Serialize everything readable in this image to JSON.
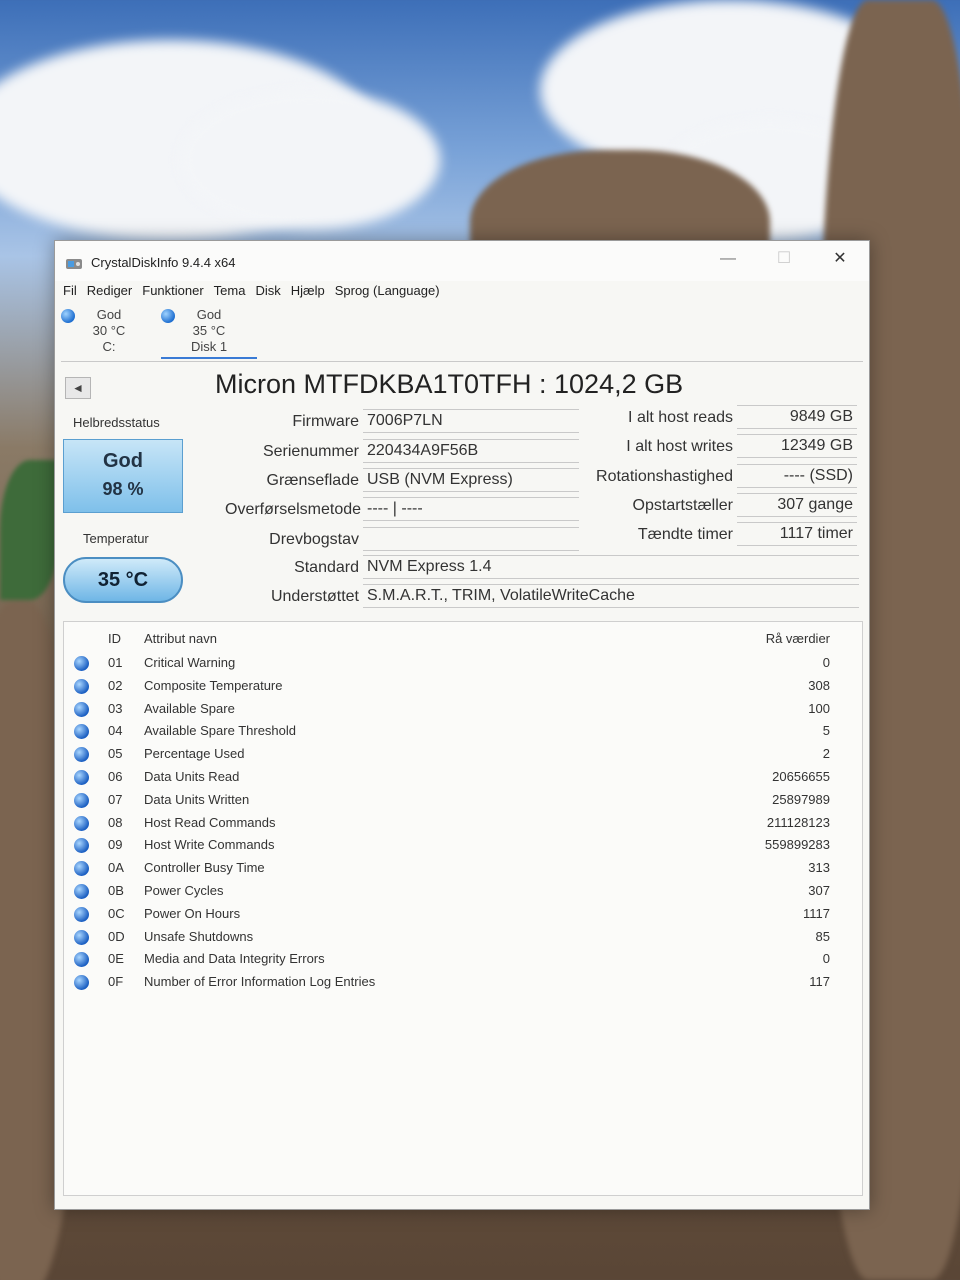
{
  "window": {
    "title": "CrystalDiskInfo 9.4.4 x64",
    "minimize_glyph": "—",
    "maximize_glyph": "☐",
    "close_glyph": "✕"
  },
  "menu": [
    "Fil",
    "Rediger",
    "Funktioner",
    "Tema",
    "Disk",
    "Hjælp",
    "Sprog (Language)"
  ],
  "disk_tabs": [
    {
      "status": "God",
      "temp": "30 °C",
      "label": "C:"
    },
    {
      "status": "God",
      "temp": "35 °C",
      "label": "Disk 1"
    }
  ],
  "model": {
    "title": "Micron MTFDKBA1T0TFH : 1024,2 GB",
    "nav_prev_glyph": "◄"
  },
  "health": {
    "label": "Helbredsstatus",
    "status": "God",
    "percent": "98 %",
    "temp_label": "Temperatur",
    "temp": "35 °C"
  },
  "info_left": [
    {
      "label": "Firmware",
      "value": "7006P7LN"
    },
    {
      "label": "Serienummer",
      "value": "220434A9F56B"
    },
    {
      "label": "Grænseflade",
      "value": "USB (NVM Express)"
    },
    {
      "label": "Overførselsmetode",
      "value": "---- | ----"
    },
    {
      "label": "Drevbogstav",
      "value": ""
    }
  ],
  "info_right": [
    {
      "label": "I alt host reads",
      "value": "9849 GB"
    },
    {
      "label": "I alt host writes",
      "value": "12349 GB"
    },
    {
      "label": "Rotationshastighed",
      "value": "---- (SSD)"
    },
    {
      "label": "Opstartstæller",
      "value": "307 gange"
    },
    {
      "label": "Tændte timer",
      "value": "1117 timer"
    }
  ],
  "info_wide": [
    {
      "label": "Standard",
      "value": "NVM Express 1.4"
    },
    {
      "label": "Understøttet",
      "value": "S.M.A.R.T., TRIM, VolatileWriteCache"
    }
  ],
  "smart": {
    "headers": {
      "id": "ID",
      "name": "Attribut navn",
      "raw": "Rå værdier"
    },
    "rows": [
      {
        "id": "01",
        "name": "Critical Warning",
        "raw": "0"
      },
      {
        "id": "02",
        "name": "Composite Temperature",
        "raw": "308"
      },
      {
        "id": "03",
        "name": "Available Spare",
        "raw": "100"
      },
      {
        "id": "04",
        "name": "Available Spare Threshold",
        "raw": "5"
      },
      {
        "id": "05",
        "name": "Percentage Used",
        "raw": "2"
      },
      {
        "id": "06",
        "name": "Data Units Read",
        "raw": "20656655"
      },
      {
        "id": "07",
        "name": "Data Units Written",
        "raw": "25897989"
      },
      {
        "id": "08",
        "name": "Host Read Commands",
        "raw": "211128123"
      },
      {
        "id": "09",
        "name": "Host Write Commands",
        "raw": "559899283"
      },
      {
        "id": "0A",
        "name": "Controller Busy Time",
        "raw": "313"
      },
      {
        "id": "0B",
        "name": "Power Cycles",
        "raw": "307"
      },
      {
        "id": "0C",
        "name": "Power On Hours",
        "raw": "1117"
      },
      {
        "id": "0D",
        "name": "Unsafe Shutdowns",
        "raw": "85"
      },
      {
        "id": "0E",
        "name": "Media and Data Integrity Errors",
        "raw": "0"
      },
      {
        "id": "0F",
        "name": "Number of Error Information Log Entries",
        "raw": "117"
      }
    ]
  },
  "colors": {
    "health_good": "#7fc0ea",
    "status_dot": "#1f6fd0"
  }
}
